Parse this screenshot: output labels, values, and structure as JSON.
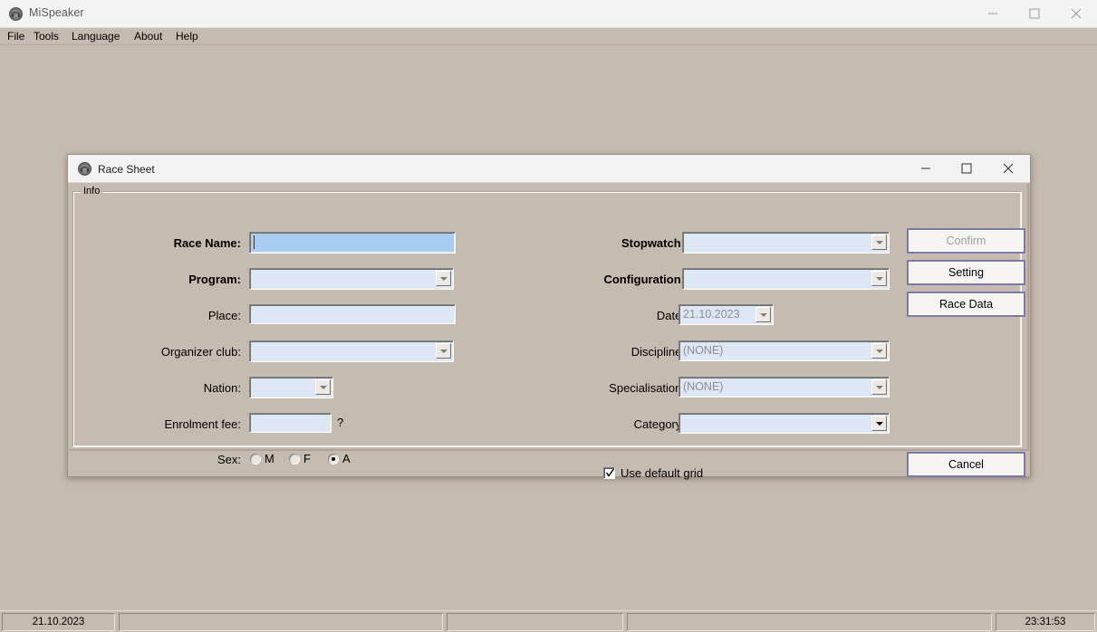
{
  "app": {
    "title": "MiSpeaker",
    "icon": "speaker-icon",
    "window_controls": {
      "minimize": "minimize-icon",
      "maximize": "maximize-icon",
      "close": "close-icon"
    },
    "menu": [
      {
        "label": "File"
      },
      {
        "label": "Tools"
      },
      {
        "label": "Language"
      },
      {
        "label": "About"
      },
      {
        "label": "Help"
      }
    ]
  },
  "statusbar": {
    "panels": [
      {
        "text": "21.10.2023"
      },
      {
        "text": ""
      },
      {
        "text": ""
      },
      {
        "text": ""
      },
      {
        "text": "23:31:53"
      }
    ]
  },
  "dialog": {
    "title": "Race Sheet",
    "icon": "speaker-icon",
    "window_controls": {
      "minimize": "minimize-icon",
      "maximize": "maximize-icon",
      "close": "close-icon"
    },
    "groupbox": {
      "legend": "Info"
    },
    "left_fields": {
      "race_name": {
        "label": "Race Name:",
        "value": "",
        "placeholder": ""
      },
      "program": {
        "label": "Program:",
        "value": "",
        "placeholder": ""
      },
      "place": {
        "label": "Place:",
        "value": "",
        "placeholder": ""
      },
      "organizer_club": {
        "label": "Organizer club:",
        "value": "",
        "placeholder": ""
      },
      "nation": {
        "label": "Nation:",
        "value": "",
        "placeholder": ""
      },
      "enrolment_fee": {
        "label": "Enrolment fee:",
        "value": "",
        "placeholder": "",
        "hint": "?"
      },
      "sex": {
        "label": "Sex:",
        "options": [
          {
            "label": "M",
            "checked": false
          },
          {
            "label": "F",
            "checked": false
          },
          {
            "label": "A",
            "checked": true
          }
        ]
      }
    },
    "right_fields": {
      "stopwatch": {
        "label": "Stopwatch:",
        "value": "",
        "placeholder": ""
      },
      "configuration": {
        "label": "Configuration:",
        "value": "",
        "placeholder": ""
      },
      "date": {
        "label": "Date:",
        "value": "21.10.2023"
      },
      "discipline": {
        "label": "Discipline:",
        "value": "(NONE)"
      },
      "specialisation": {
        "label": "Specialisation:",
        "value": "(NONE)"
      },
      "category": {
        "label": "Category:",
        "value": "",
        "placeholder": ""
      },
      "use_default_grid": {
        "label": "Use default grid",
        "checked": true
      }
    },
    "buttons": {
      "confirm": {
        "label": "Confirm",
        "enabled": false
      },
      "setting": {
        "label": "Setting",
        "enabled": true
      },
      "race_data": {
        "label": "Race Data",
        "enabled": true
      },
      "cancel": {
        "label": "Cancel",
        "enabled": true
      }
    }
  },
  "colors": {
    "window_bg": "#c6bbb0",
    "titlebar_bg": "#f3f3f3",
    "field_bg": "#dde7f5",
    "field_focus_bg": "#a8cdf0",
    "button_border": "#7b79a8",
    "disabled_text": "#9d9d9d"
  }
}
